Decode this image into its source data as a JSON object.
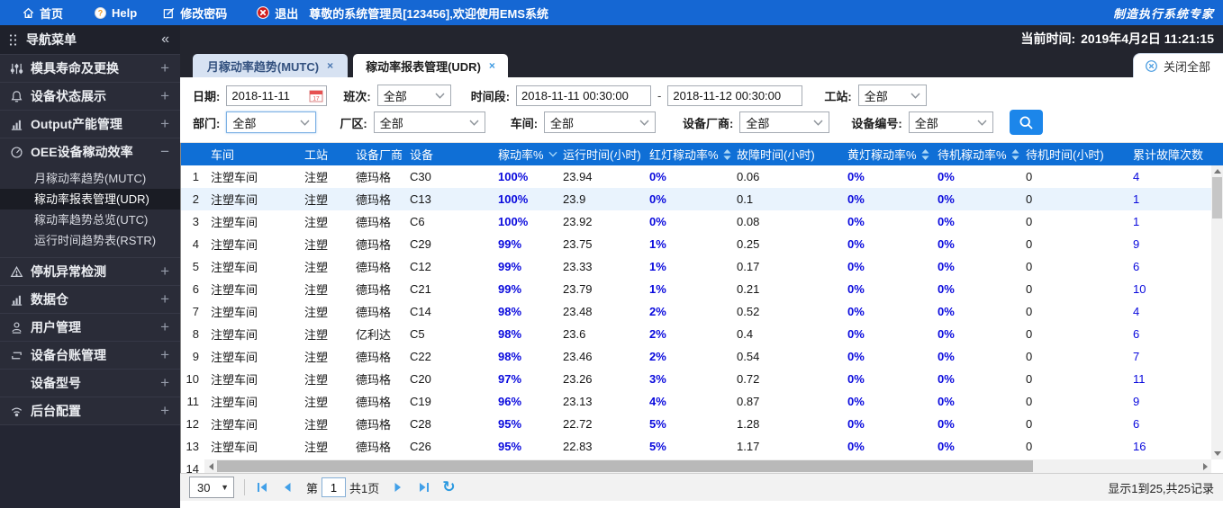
{
  "colors": {
    "topbar_blue": "#1567d3",
    "header_blue": "#0f6fd6",
    "accent_blue": "#1c86ea",
    "value_blue": "#0909dd",
    "tab_inactive_bg": "#d7e2f2",
    "selected_row_bg": "#e9f3fd",
    "pager_blue": "#42a0e8"
  },
  "topbar": {
    "menu": [
      {
        "label": "首页",
        "icon": "home-icon"
      },
      {
        "label": "Help",
        "icon": "help-icon"
      },
      {
        "label": "修改密码",
        "icon": "edit-icon"
      },
      {
        "label": "退出",
        "icon": "logout-icon"
      }
    ],
    "welcome": "尊敬的系统管理员[123456],欢迎使用EMS系统",
    "brand": "制造执行系统专家"
  },
  "statusbar": {
    "current_time_label": "当前时间:",
    "current_time": "2019年4月2日 11:21:15"
  },
  "sidebar": {
    "title": "导航菜单",
    "collapse_glyph": "«",
    "groups": [
      {
        "label": "模具寿命及更换",
        "icon": "sliders-icon",
        "state": "collapsed"
      },
      {
        "label": "设备状态展示",
        "icon": "bell-icon",
        "state": "collapsed"
      },
      {
        "label": "Output产能管理",
        "icon": "bar-chart-icon",
        "state": "collapsed"
      },
      {
        "label": "OEE设备稼动效率",
        "icon": "gauge-icon",
        "state": "expanded",
        "children": [
          {
            "label": "月稼动率趋势(MUTC)",
            "selected": false
          },
          {
            "label": "稼动率报表管理(UDR)",
            "selected": true
          },
          {
            "label": "稼动率趋势总览(UTC)",
            "selected": false
          },
          {
            "label": "运行时间趋势表(RSTR)",
            "selected": false
          }
        ]
      },
      {
        "label": "停机异常检测",
        "icon": "warning-icon",
        "state": "collapsed"
      },
      {
        "label": "数据仓",
        "icon": "bar-chart-icon",
        "state": "collapsed"
      },
      {
        "label": "用户管理",
        "icon": "user-icon",
        "state": "collapsed"
      },
      {
        "label": "设备台账管理",
        "icon": "ledger-icon",
        "state": "collapsed"
      },
      {
        "label": "设备型号",
        "icon": "none",
        "state": "collapsed"
      },
      {
        "label": "后台配置",
        "icon": "wifi-icon",
        "state": "collapsed"
      }
    ]
  },
  "tabs": [
    {
      "label": "月稼动率趋势(MUTC)",
      "active": false
    },
    {
      "label": "稼动率报表管理(UDR)",
      "active": true
    }
  ],
  "close_all_label": "关闭全部",
  "filters": {
    "date_label": "日期:",
    "date_value": "2018-11-11",
    "shift_label": "班次:",
    "shift_value": "全部",
    "timespan_label": "时间段:",
    "time_from": "2018-11-11 00:30:00",
    "range_separator": "-",
    "time_to": "2018-11-12 00:30:00",
    "station_label": "工站:",
    "station_value": "全部",
    "dept_label": "部门:",
    "dept_value": "全部",
    "plant_label": "厂区:",
    "plant_value": "全部",
    "workshop_label": "车间:",
    "workshop_value": "全部",
    "vendor_label": "设备厂商:",
    "vendor_value": "全部",
    "device_label": "设备编号:",
    "device_value": "全部",
    "search_icon": "search-icon"
  },
  "table": {
    "columns": [
      {
        "label": "车间",
        "sort": "none"
      },
      {
        "label": "工站",
        "sort": "none"
      },
      {
        "label": "设备厂商",
        "sort": "none"
      },
      {
        "label": "设备",
        "sort": "none"
      },
      {
        "label": "稼动率%",
        "sort": "desc"
      },
      {
        "label": "运行时间(小时)",
        "sort": "none"
      },
      {
        "label": "红灯稼动率%",
        "sort": "both"
      },
      {
        "label": "故障时间(小时)",
        "sort": "none"
      },
      {
        "label": "黄灯稼动率%",
        "sort": "both"
      },
      {
        "label": "待机稼动率%",
        "sort": "both"
      },
      {
        "label": "待机时间(小时)",
        "sort": "none"
      },
      {
        "label": "累计故障次数",
        "sort": "none"
      }
    ],
    "rows": [
      {
        "num": "1",
        "selected": false,
        "cells": [
          "注塑车间",
          "注塑",
          "德玛格",
          "C30",
          "100%",
          "23.94",
          "0%",
          "0.06",
          "0%",
          "0%",
          "0",
          "4"
        ]
      },
      {
        "num": "2",
        "selected": true,
        "cells": [
          "注塑车间",
          "注塑",
          "德玛格",
          "C13",
          "100%",
          "23.9",
          "0%",
          "0.1",
          "0%",
          "0%",
          "0",
          "1"
        ]
      },
      {
        "num": "3",
        "selected": false,
        "cells": [
          "注塑车间",
          "注塑",
          "德玛格",
          "C6",
          "100%",
          "23.92",
          "0%",
          "0.08",
          "0%",
          "0%",
          "0",
          "1"
        ]
      },
      {
        "num": "4",
        "selected": false,
        "cells": [
          "注塑车间",
          "注塑",
          "德玛格",
          "C29",
          "99%",
          "23.75",
          "1%",
          "0.25",
          "0%",
          "0%",
          "0",
          "9"
        ]
      },
      {
        "num": "5",
        "selected": false,
        "cells": [
          "注塑车间",
          "注塑",
          "德玛格",
          "C12",
          "99%",
          "23.33",
          "1%",
          "0.17",
          "0%",
          "0%",
          "0",
          "6"
        ]
      },
      {
        "num": "6",
        "selected": false,
        "cells": [
          "注塑车间",
          "注塑",
          "德玛格",
          "C21",
          "99%",
          "23.79",
          "1%",
          "0.21",
          "0%",
          "0%",
          "0",
          "10"
        ]
      },
      {
        "num": "7",
        "selected": false,
        "cells": [
          "注塑车间",
          "注塑",
          "德玛格",
          "C14",
          "98%",
          "23.48",
          "2%",
          "0.52",
          "0%",
          "0%",
          "0",
          "4"
        ]
      },
      {
        "num": "8",
        "selected": false,
        "cells": [
          "注塑车间",
          "注塑",
          "亿利达",
          "C5",
          "98%",
          "23.6",
          "2%",
          "0.4",
          "0%",
          "0%",
          "0",
          "6"
        ]
      },
      {
        "num": "9",
        "selected": false,
        "cells": [
          "注塑车间",
          "注塑",
          "德玛格",
          "C22",
          "98%",
          "23.46",
          "2%",
          "0.54",
          "0%",
          "0%",
          "0",
          "7"
        ]
      },
      {
        "num": "10",
        "selected": false,
        "cells": [
          "注塑车间",
          "注塑",
          "德玛格",
          "C20",
          "97%",
          "23.26",
          "3%",
          "0.72",
          "0%",
          "0%",
          "0",
          "11"
        ]
      },
      {
        "num": "11",
        "selected": false,
        "cells": [
          "注塑车间",
          "注塑",
          "德玛格",
          "C19",
          "96%",
          "23.13",
          "4%",
          "0.87",
          "0%",
          "0%",
          "0",
          "9"
        ]
      },
      {
        "num": "12",
        "selected": false,
        "cells": [
          "注塑车间",
          "注塑",
          "德玛格",
          "C28",
          "95%",
          "22.72",
          "5%",
          "1.28",
          "0%",
          "0%",
          "0",
          "6"
        ]
      },
      {
        "num": "13",
        "selected": false,
        "cells": [
          "注塑车间",
          "注塑",
          "德玛格",
          "C26",
          "95%",
          "22.83",
          "5%",
          "1.17",
          "0%",
          "0%",
          "0",
          "16"
        ]
      }
    ],
    "partial_row_number": "14"
  },
  "pagination": {
    "page_size": "30",
    "page_prefix": "第",
    "page_value": "1",
    "page_total": "共1页",
    "summary": "显示1到25,共25记录"
  }
}
